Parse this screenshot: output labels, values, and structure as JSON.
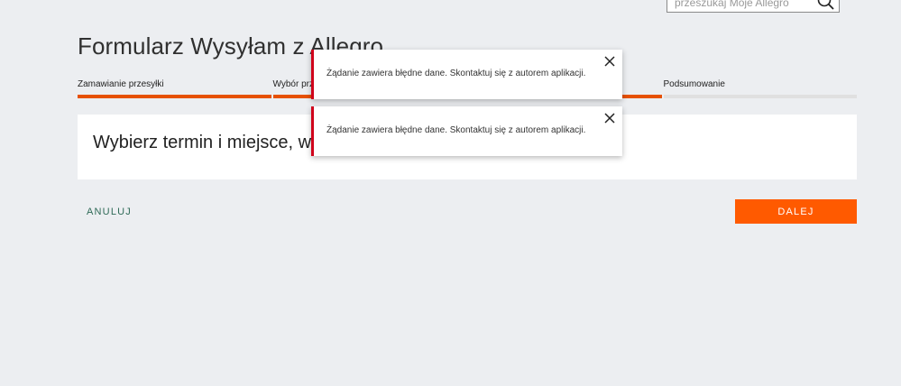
{
  "search": {
    "placeholder": "przeszukaj Moje Allegro"
  },
  "page": {
    "title": "Formularz Wysyłam z Allegro"
  },
  "stepper": {
    "steps": [
      {
        "label": "Zamawianie przesyłki",
        "done": true
      },
      {
        "label": "Wybór przewoźnika",
        "done": true
      },
      {
        "label": "",
        "done": true
      },
      {
        "label": "Podsumowanie",
        "done": false
      }
    ]
  },
  "card": {
    "heading": "Wybierz termin i miejsce, w"
  },
  "actions": {
    "cancel_label": "ANULUJ",
    "next_label": "DALEJ"
  },
  "toasts": [
    {
      "message": "Żądanie zawiera błędne dane. Skontaktuj się z autorem aplikacji."
    },
    {
      "message": "Żądanie zawiera błędne dane. Skontaktuj się z autorem aplikacji."
    }
  ],
  "colors": {
    "accent": "#ff5a00",
    "step_done": "#e65100",
    "error": "#d0021b",
    "link": "#2f6a57"
  }
}
